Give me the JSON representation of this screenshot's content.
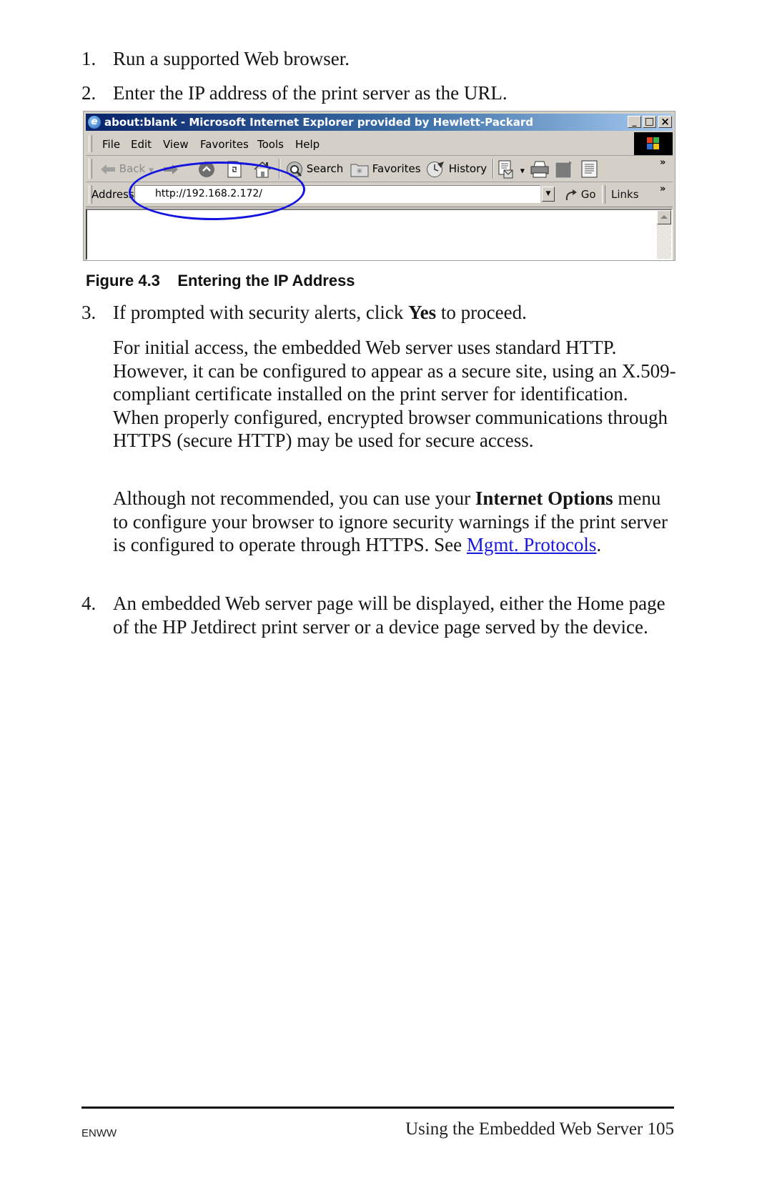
{
  "steps": [
    {
      "num": "1.",
      "text": "Run a supported Web browser."
    },
    {
      "num": "2.",
      "text": "Enter the IP address of the print server as the URL."
    },
    {
      "num": "3.",
      "text_before": "If prompted with security alerts, click ",
      "bold": "Yes",
      "text_after": " to proceed."
    },
    {
      "num": "4.",
      "text": "An embedded Web server page will be displayed, either the Home page of the HP Jetdirect print server or a device page served by the device."
    }
  ],
  "paragraphs": {
    "https_info": "For initial access, the embedded Web server uses standard HTTP. However, it can be configured to appear as a secure site, using an X.509-compliant certificate installed on the print server for identification. When properly configured, encrypted browser communications through HTTPS (secure HTTP) may be used for secure access.",
    "internet_options": {
      "before": "Although not recommended, you can use your ",
      "bold": "Internet Options",
      "middle": " menu to configure your browser to ignore security warnings if the print server is configured to operate through HTTPS. See ",
      "link": "Mgmt. Protocols",
      "after": "."
    }
  },
  "figure": {
    "caption": "Figure 4.3    Entering the IP Address",
    "browser": {
      "title": "about:blank - Microsoft Internet Explorer provided by Hewlett-Packard",
      "window_buttons": {
        "minimize": "_",
        "maximize": "□",
        "close": "×"
      },
      "menu": [
        "File",
        "Edit",
        "View",
        "Favorites",
        "Tools",
        "Help"
      ],
      "toolbar": {
        "back": "Back",
        "search": "Search",
        "favorites": "Favorites",
        "history": "History",
        "overflow": "»"
      },
      "address_label": "Address",
      "address_value": "http://192.168.2.172/",
      "go_label": "Go",
      "links_label": "Links",
      "links_overflow": "»",
      "highlight_color": "#1414e0"
    }
  },
  "footer": {
    "left": "ENWW",
    "right": "Using the Embedded Web Server 105"
  }
}
